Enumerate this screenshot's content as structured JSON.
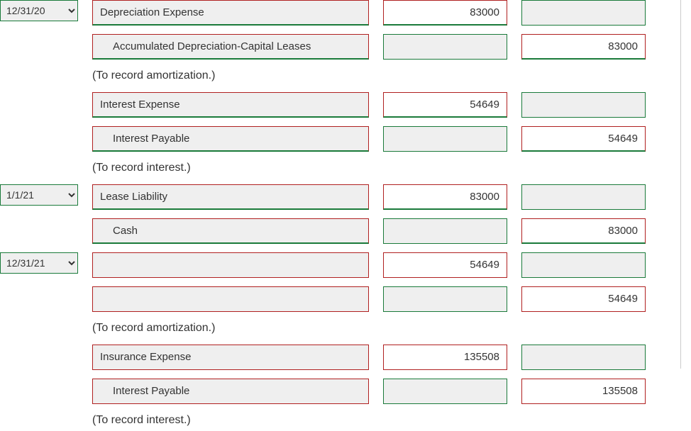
{
  "dates": {
    "d1": "12/31/20",
    "d2": "1/1/21",
    "d3": "12/31/21"
  },
  "rows": {
    "r1_acct": "Depreciation Expense",
    "r1_debit": "83000",
    "r2_acct": "Accumulated Depreciation-Capital Leases",
    "r2_credit": "83000",
    "cap1": "(To record amortization.)",
    "r3_acct": "Interest Expense",
    "r3_debit": "54649",
    "r4_acct": "Interest Payable",
    "r4_credit": "54649",
    "cap2": "(To record interest.)",
    "r5_acct": "Lease Liability",
    "r5_debit": "83000",
    "r6_acct": "Cash",
    "r6_credit": "83000",
    "r7_acct": "",
    "r7_debit": "54649",
    "r8_acct": "",
    "r8_credit": "54649",
    "cap3": "(To record amortization.)",
    "r9_acct": "Insurance Expense",
    "r9_debit": "135508",
    "r10_acct": "Interest Payable",
    "r10_credit": "135508",
    "cap4": "(To record interest.)"
  }
}
